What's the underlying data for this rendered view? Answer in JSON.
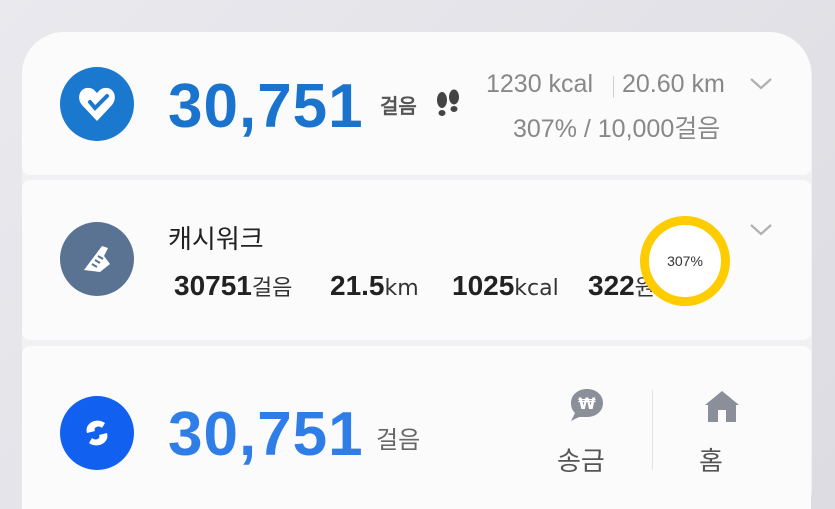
{
  "health_widget": {
    "steps": "30,751",
    "steps_unit": "걸음",
    "calories": "1230 kcal",
    "distance": "20.60 km",
    "goal_text": "307% / 10,000걸음",
    "icon": "heart-icon",
    "accent_color": "#1a73cc"
  },
  "cashwalk_widget": {
    "title": "캐시워크",
    "steps_value": "30751",
    "steps_unit": "걸음",
    "distance_value": "21.5",
    "distance_unit": "km",
    "calories_value": "1025",
    "calories_unit": "kcal",
    "points_value": "322",
    "points_unit": "원",
    "progress_label": "307%",
    "ring_color": "#ffcc00",
    "icon": "running-shoe-icon"
  },
  "toss_widget": {
    "steps": "30,751",
    "steps_unit": "걸음",
    "send_label": "송금",
    "home_label": "홈",
    "icon": "toss-icon",
    "accent_color": "#1160f0"
  }
}
